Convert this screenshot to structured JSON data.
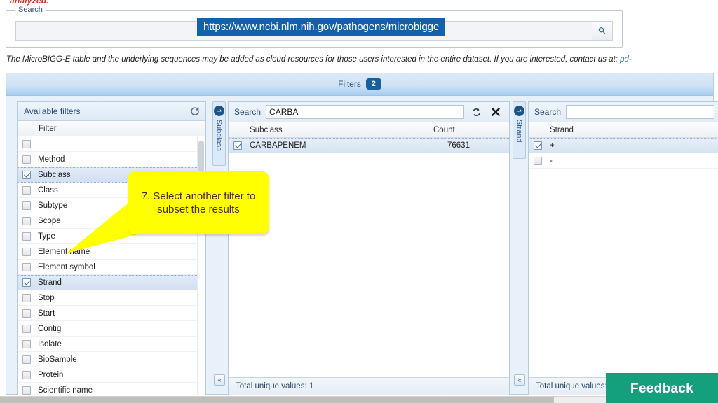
{
  "page": {
    "cutoff_text": "analyzed.",
    "info_text": "The MicroBIGG-E table and the underlying sequences may be added as cloud resources for those users interested in the entire dataset. If you are interested, contact us at:",
    "info_link": "pd-",
    "url_overlay": "https://www.ncbi.nlm.nih.gov/pathogens/microbigge"
  },
  "search": {
    "legend": "Search",
    "value": "",
    "placeholder": "",
    "magnifier_icon": "search-icon"
  },
  "filters_bar": {
    "title": "Filters",
    "count": "2"
  },
  "available_filters": {
    "header": "Available filters",
    "refresh_icon": "refresh-icon",
    "column_header": "Filter",
    "items": [
      {
        "label": "Scientific name",
        "checked": false
      },
      {
        "label": "Protein",
        "checked": false
      },
      {
        "label": "BioSample",
        "checked": false
      },
      {
        "label": "Isolate",
        "checked": false
      },
      {
        "label": "Contig",
        "checked": false
      },
      {
        "label": "Start",
        "checked": false
      },
      {
        "label": "Stop",
        "checked": false
      },
      {
        "label": "Strand",
        "checked": true
      },
      {
        "label": "Element symbol",
        "checked": false
      },
      {
        "label": "Element name",
        "checked": false
      },
      {
        "label": "Type",
        "checked": false
      },
      {
        "label": "Scope",
        "checked": false
      },
      {
        "label": "Subtype",
        "checked": false
      },
      {
        "label": "Class",
        "checked": false
      },
      {
        "label": "Subclass",
        "checked": true
      },
      {
        "label": "Method",
        "checked": false
      },
      {
        "label": "",
        "checked": false
      }
    ]
  },
  "subclass_panel": {
    "tab_number": "1",
    "tab_label": "Subclass",
    "search_label": "Search",
    "search_value": "CARBA",
    "refresh_icon": "refresh-icon",
    "clear_icon": "close-icon",
    "columns": [
      "Subclass",
      "Count"
    ],
    "rows": [
      {
        "name": "CARBAPENEM",
        "count": "76631",
        "checked": true
      }
    ],
    "footer": "Total unique values: 1",
    "collapse_label": "«"
  },
  "strand_panel": {
    "tab_number": "1",
    "tab_label": "Strand",
    "search_label": "Search",
    "search_value": "",
    "columns": [
      "Strand"
    ],
    "rows": [
      {
        "name": "+",
        "checked": true
      },
      {
        "name": "-",
        "checked": false
      }
    ],
    "footer": "Total unique values: 2",
    "collapse_label": "«"
  },
  "callout": {
    "text": "7. Select another filter to subset the results"
  },
  "feedback": {
    "label": "Feedback"
  },
  "colors": {
    "accent_blue": "#1161ad",
    "callout_yellow": "#ffff00",
    "callout_text": "#4a2d12",
    "feedback_green": "#15a07d",
    "red_text": "#d13a2a"
  }
}
